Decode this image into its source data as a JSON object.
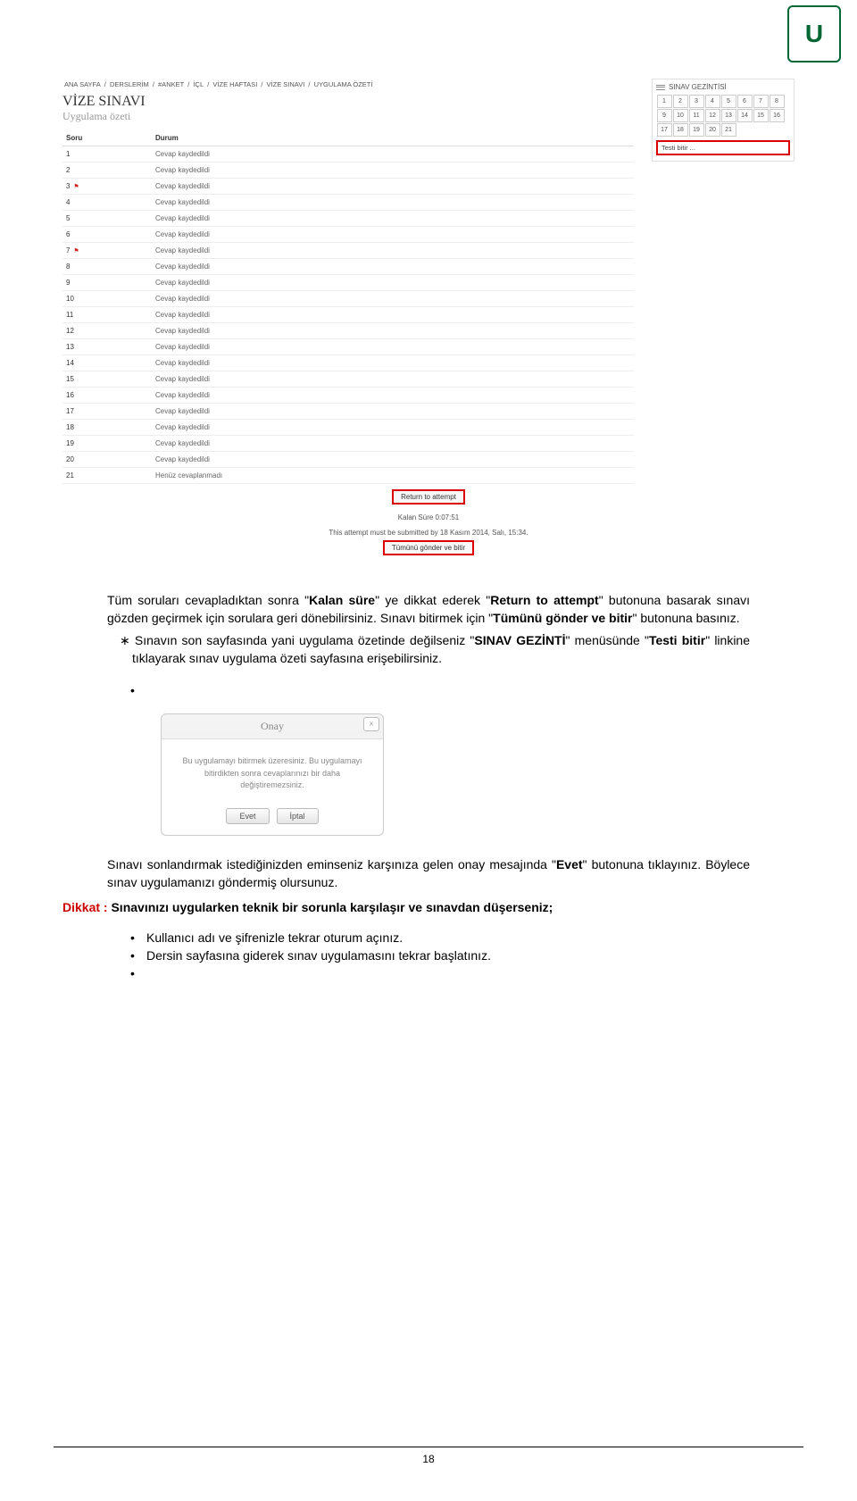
{
  "breadcrumb": [
    "ANA SAYFA",
    "DERSLERİM",
    "#ANKET",
    "İÇL",
    "VİZE HAFTASI",
    "VİZE SINAVI",
    "UYGULAMA ÖZETİ"
  ],
  "title": "VİZE SINAVI",
  "subtitle": "Uygulama özeti",
  "table": {
    "col_soru": "Soru",
    "col_durum": "Durum",
    "rows": [
      {
        "q": "1",
        "flag": false,
        "status": "Cevap kaydedildi"
      },
      {
        "q": "2",
        "flag": false,
        "status": "Cevap kaydedildi"
      },
      {
        "q": "3",
        "flag": true,
        "status": "Cevap kaydedildi"
      },
      {
        "q": "4",
        "flag": false,
        "status": "Cevap kaydedildi"
      },
      {
        "q": "5",
        "flag": false,
        "status": "Cevap kaydedildi"
      },
      {
        "q": "6",
        "flag": false,
        "status": "Cevap kaydedildi"
      },
      {
        "q": "7",
        "flag": true,
        "status": "Cevap kaydedildi"
      },
      {
        "q": "8",
        "flag": false,
        "status": "Cevap kaydedildi"
      },
      {
        "q": "9",
        "flag": false,
        "status": "Cevap kaydedildi"
      },
      {
        "q": "10",
        "flag": false,
        "status": "Cevap kaydedildi"
      },
      {
        "q": "11",
        "flag": false,
        "status": "Cevap kaydedildi"
      },
      {
        "q": "12",
        "flag": false,
        "status": "Cevap kaydedildi"
      },
      {
        "q": "13",
        "flag": false,
        "status": "Cevap kaydedildi"
      },
      {
        "q": "14",
        "flag": false,
        "status": "Cevap kaydedildi"
      },
      {
        "q": "15",
        "flag": false,
        "status": "Cevap kaydedildi"
      },
      {
        "q": "16",
        "flag": false,
        "status": "Cevap kaydedildi"
      },
      {
        "q": "17",
        "flag": false,
        "status": "Cevap kaydedildi"
      },
      {
        "q": "18",
        "flag": false,
        "status": "Cevap kaydedildi"
      },
      {
        "q": "19",
        "flag": false,
        "status": "Cevap kaydedildi"
      },
      {
        "q": "20",
        "flag": false,
        "status": "Cevap kaydedildi"
      },
      {
        "q": "21",
        "flag": false,
        "status": "Henüz cevaplanmadı"
      }
    ]
  },
  "nav": {
    "title": "SINAV GEZİNTİSİ",
    "items": [
      "1",
      "2",
      "3",
      "4",
      "5",
      "6",
      "7",
      "8",
      "9",
      "10",
      "11",
      "12",
      "13",
      "14",
      "15",
      "16",
      "17",
      "18",
      "19",
      "20",
      "21"
    ],
    "finish": "Testi bitir ..."
  },
  "buttons": {
    "return": "Return to attempt",
    "submit": "Tümünü gönder ve bitir"
  },
  "timer_label": "Kalan Süre 0:07:51",
  "deadline": "This attempt must be submitted by 18 Kasım 2014, Salı, 15:34.",
  "para1a": "Tüm soruları cevapladıktan sonra \"",
  "para1_kalan": "Kalan süre",
  "para1b": "\" ye dikkat ederek \"",
  "para1_return": "Return to attempt",
  "para1c": "\" butonuna basarak sınavı gözden geçirmek için sorulara geri dönebilirsiniz. Sınavı bitirmek için \"",
  "para1_tum": "Tümünü gönder ve bitir",
  "para1d": "\" butonuna basınız.",
  "ast_a": "Sınavın son sayfasında yani uygulama özetinde değilseniz \"",
  "ast_s1": "SINAV GEZİNTİ",
  "ast_b": "\" menüsünde \"",
  "ast_s2": "Testi bitir",
  "ast_c": "\" linkine tıklayarak sınav uygulama özeti sayfasına erişebilirsiniz.",
  "dialog": {
    "title": "Onay",
    "body": "Bu uygulamayı bitirmek üzeresiniz. Bu uygulamayı bitirdikten sonra cevaplarınızı bir daha değiştiremezsiniz.",
    "yes": "Evet",
    "cancel": "İptal"
  },
  "para2a": "Sınavı sonlandırmak istediğinizden eminseniz karşınıza gelen onay mesajında \"",
  "para2_evet": "Evet",
  "para2b": "\" butonuna tıklayınız. Böylece sınav uygulamanızı göndermiş olursunuz.",
  "dikkat_label": "Dikkat : ",
  "dikkat_text": "Sınavınızı uygularken teknik bir sorunla karşılaşır ve sınavdan düşerseniz;",
  "bullet1": "Kullanıcı adı ve şifrenizle tekrar oturum açınız.",
  "bullet2": "Dersin sayfasına giderek sınav uygulamasını tekrar başlatınız.",
  "page_number": "18"
}
